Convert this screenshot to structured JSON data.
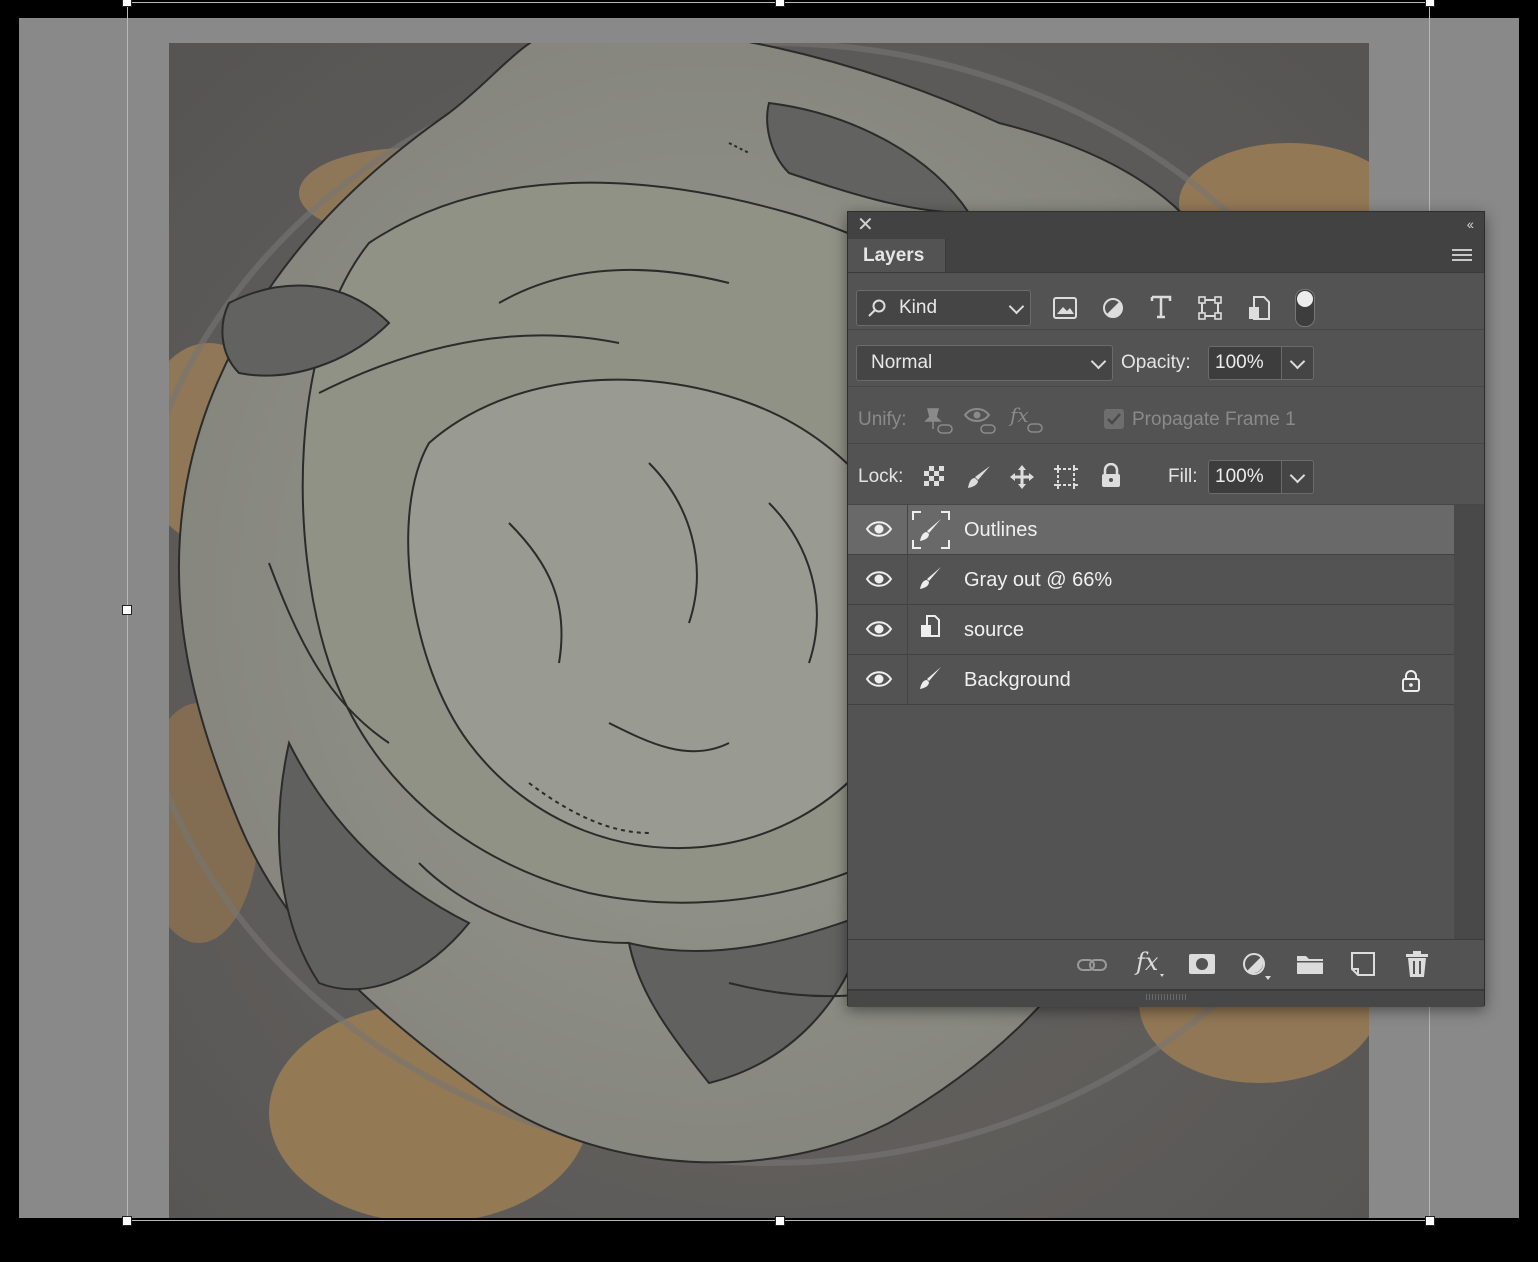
{
  "panel": {
    "tab_label": "Layers",
    "filter": {
      "kind_label": "Kind"
    },
    "blend": {
      "mode": "Normal",
      "opacity_label": "Opacity:",
      "opacity_value": "100%"
    },
    "unify": {
      "label": "Unify:",
      "propagate_label": "Propagate Frame 1",
      "propagate_checked": true
    },
    "lock": {
      "label": "Lock:",
      "fill_label": "Fill:",
      "fill_value": "100%"
    },
    "layers": [
      {
        "name": "Outlines",
        "visible": true,
        "selected": true,
        "thumb": "brush-mask-icon",
        "locked": false
      },
      {
        "name": "Gray out @ 66%",
        "visible": true,
        "selected": false,
        "thumb": "brush-icon",
        "locked": false
      },
      {
        "name": "source",
        "visible": true,
        "selected": false,
        "thumb": "smart-object-icon",
        "locked": false
      },
      {
        "name": "Background",
        "visible": true,
        "selected": false,
        "thumb": "brush-icon",
        "locked": true
      }
    ]
  },
  "colors": {
    "panel_bg": "#535353",
    "selected_layer": "#696969",
    "canvas_pasteboard": "#898989"
  }
}
